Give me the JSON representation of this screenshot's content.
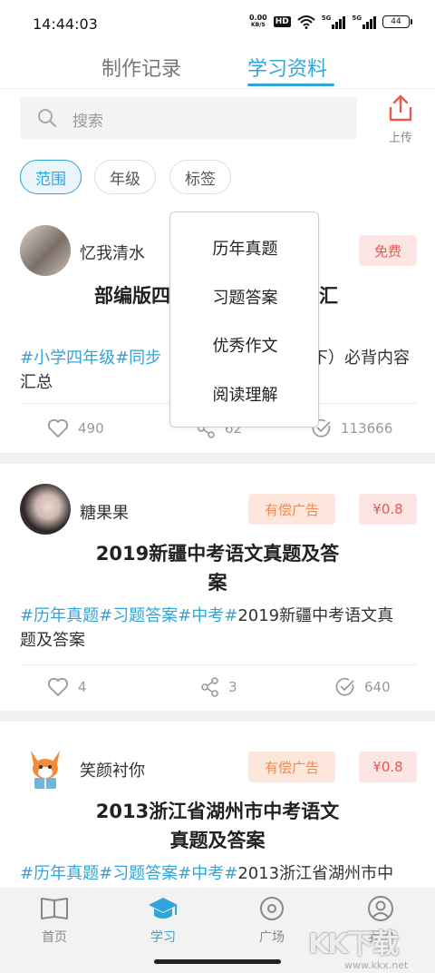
{
  "status_bar": {
    "time": "14:44:03",
    "net_speed_value": "0.00",
    "net_speed_unit": "KB/S",
    "hd_label": "HD",
    "signal_1_label": "5G",
    "signal_2_label": "5G",
    "battery": "44"
  },
  "tabs": [
    {
      "label": "制作记录",
      "active": false
    },
    {
      "label": "学习资料",
      "active": true
    }
  ],
  "search": {
    "placeholder": "搜索"
  },
  "upload": {
    "label": "上传"
  },
  "filters": [
    {
      "label": "范围",
      "active": true
    },
    {
      "label": "年级",
      "active": false
    },
    {
      "label": "标签",
      "active": false
    }
  ],
  "dropdown": {
    "options": [
      "历年真题",
      "习题答案",
      "优秀作文",
      "阅读理解"
    ]
  },
  "cards": [
    {
      "user": "忆我清水",
      "badges": [
        "免费"
      ],
      "title_line1": "部编版四",
      "title_line2": "汇",
      "desc_tags": "#小学四年级#同步",
      "desc_text_mid": "下）必背内容",
      "desc_text_2": "汇总",
      "likes": "490",
      "shares": "62",
      "views": "113666"
    },
    {
      "user": "糖果果",
      "badges": [
        "有偿广告",
        "¥0.8"
      ],
      "title_line1": "2019新疆中考语文真题及答",
      "title_line2": "案",
      "desc_tags": "#历年真题#习题答案#中考#",
      "desc_text_1": "2019新疆中考语文真",
      "desc_text_2": "题及答案",
      "likes": "4",
      "shares": "3",
      "views": "640"
    },
    {
      "user": "笑颜衬你",
      "badges": [
        "有偿广告",
        "¥0.8"
      ],
      "title_line1": "2013浙江省湖州市中考语文",
      "title_line2": "真题及答案",
      "desc_tags": "#历年真题#习题答案#中考#",
      "desc_text_1": "2013浙江省湖州市中"
    }
  ],
  "bottom_nav": [
    {
      "label": "首页",
      "icon": "book-icon",
      "active": false
    },
    {
      "label": "学习",
      "icon": "graduation-cap-icon",
      "active": true
    },
    {
      "label": "广场",
      "icon": "compass-icon",
      "active": false
    },
    {
      "label": "我的",
      "icon": "user-icon",
      "active": false
    }
  ],
  "watermark": {
    "text": "KK下载",
    "url": "www.kkx.net"
  },
  "colors": {
    "accent": "#2fa5da",
    "ad_badge": "#f08c50",
    "price_badge": "#e85a4f",
    "free_badge": "#e85a4f"
  }
}
